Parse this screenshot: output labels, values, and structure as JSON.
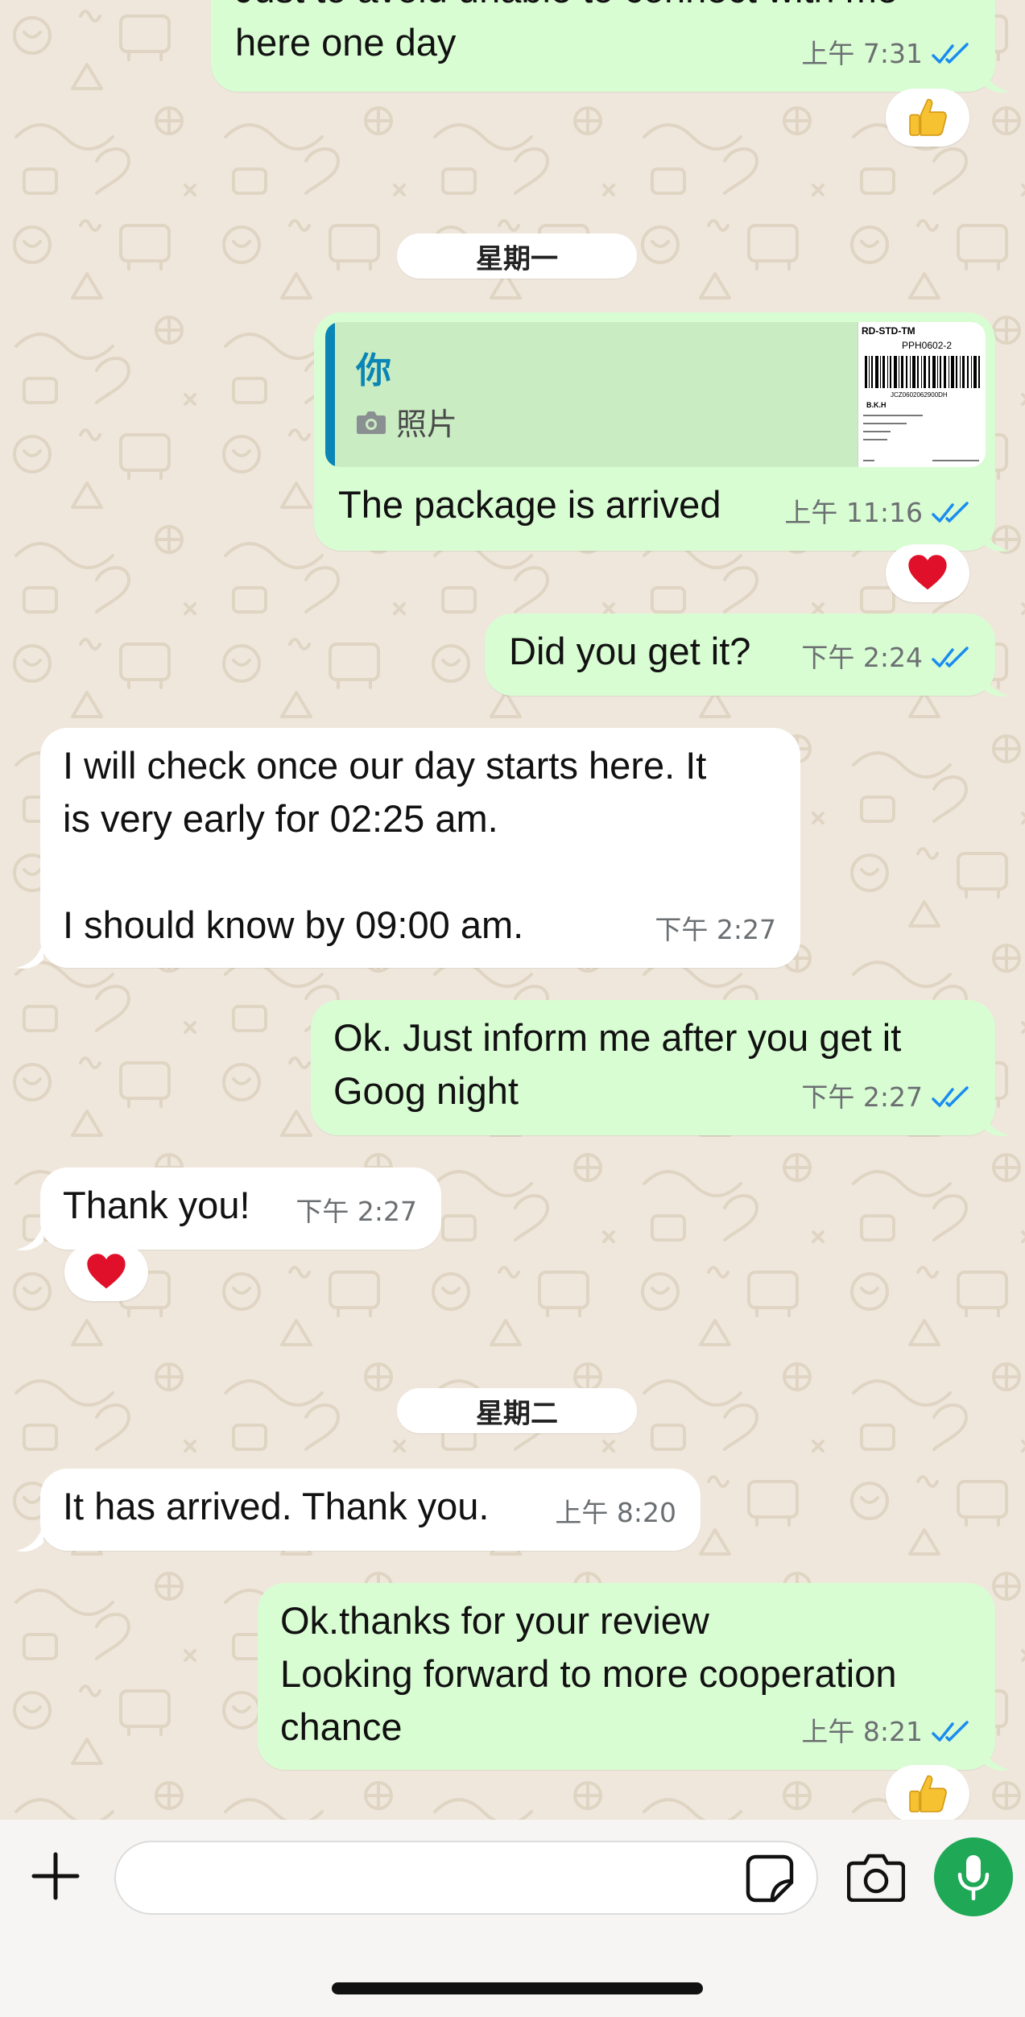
{
  "chat": {
    "day_labels": {
      "monday": "星期一",
      "tuesday": "星期二"
    },
    "messages": [
      {
        "id": "m1",
        "direction": "outgoing",
        "text": "Just to avoid unable to connect with me\nhere one day",
        "time": "上午 7:31",
        "status": "read",
        "reaction": "thumbs-up"
      },
      {
        "id": "m2",
        "direction": "outgoing",
        "quote": {
          "author": "你",
          "kind": "照片"
        },
        "text": "The package is arrived",
        "time": "上午 11:16",
        "status": "read",
        "reaction": "heart"
      },
      {
        "id": "m3",
        "direction": "outgoing",
        "text": "Did you get it?",
        "time": "下午 2:24",
        "status": "read"
      },
      {
        "id": "m4",
        "direction": "incoming",
        "text": "I will check once our day starts here. It\nis very early for 02:25 am.\n\nI should know by 09:00 am.",
        "time": "下午 2:27"
      },
      {
        "id": "m5",
        "direction": "outgoing",
        "text": "Ok. Just inform me after you get it\nGoog night",
        "time": "下午 2:27",
        "status": "read"
      },
      {
        "id": "m6",
        "direction": "incoming",
        "text": "Thank you!",
        "time": "下午 2:27",
        "reaction": "heart"
      },
      {
        "id": "m7",
        "direction": "incoming",
        "text": "It has arrived. Thank you.",
        "time": "上午 8:20"
      },
      {
        "id": "m8",
        "direction": "outgoing",
        "text": "Ok.thanks for your review\nLooking forward to more cooperation\nchance",
        "time": "上午 8:21",
        "status": "read",
        "reaction": "thumbs-up"
      }
    ],
    "quote_thumbnail": {
      "line1": "RD-STD-TM",
      "line2": "PPH0602-2",
      "line3": "JCZ0602062900DH",
      "line4": "B.K.H"
    }
  },
  "composer": {
    "placeholder": "",
    "value": ""
  },
  "colors": {
    "outgoing_bubble": "#d9fdd3",
    "incoming_bubble": "#ffffff",
    "read_ticks": "#1a8cf0",
    "mic_button": "#1fa855",
    "quote_accent": "#0a85b5",
    "heart": "#e0102a",
    "thumbs_up": "#f7c232"
  },
  "icons": {
    "plus": "plus-icon",
    "sticker": "sticker-icon",
    "camera": "camera-icon",
    "mic": "microphone-icon",
    "read_receipt": "double-check-icon"
  }
}
